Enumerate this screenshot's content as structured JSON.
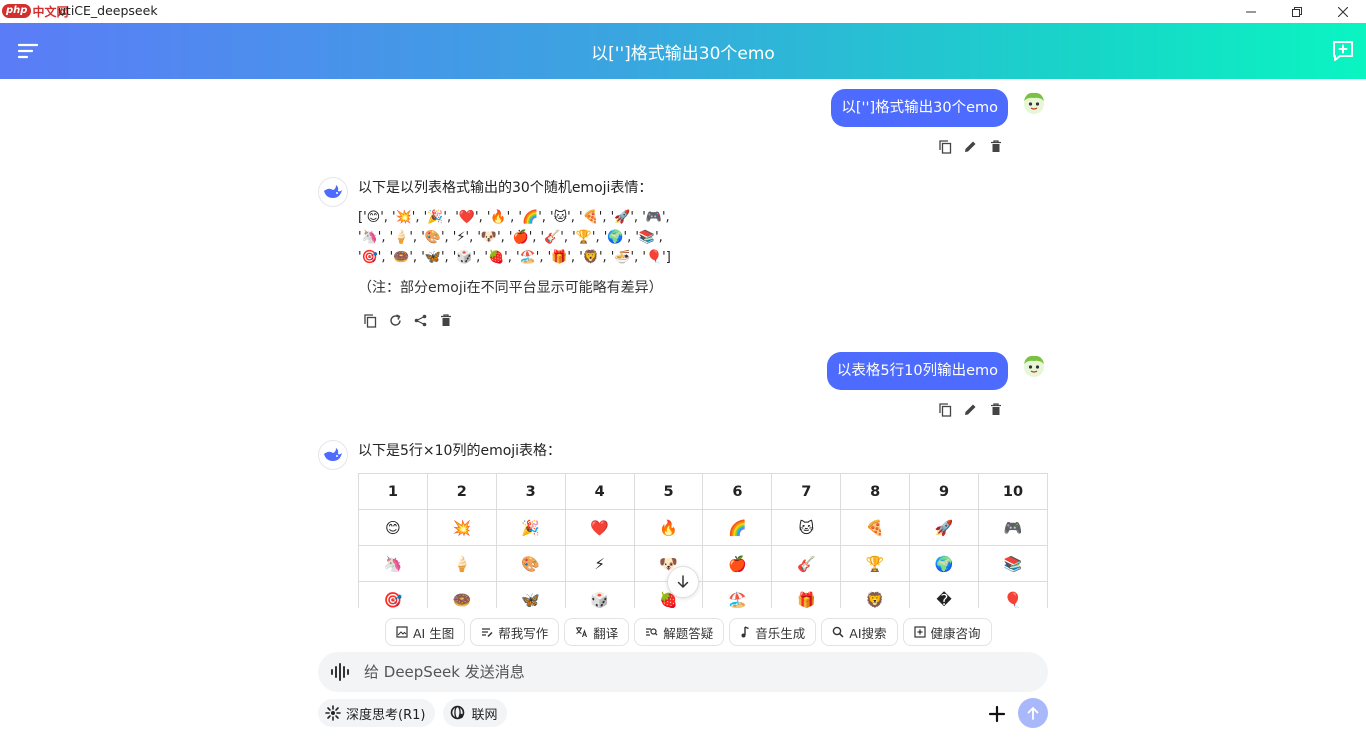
{
  "window": {
    "logo_php": "php",
    "logo_cn": "中文网",
    "title": "utiCE_deepseek"
  },
  "header": {
    "title": "以['']格式输出30个emo"
  },
  "messages": [
    {
      "role": "user",
      "text": "以['']格式输出30个emo"
    },
    {
      "role": "assistant",
      "intro": "以下是以列表格式输出的30个随机emoji表情：",
      "lines": [
        "['😊', '💥', '🎉', '❤️', '🔥', '🌈', '🐱', '🍕', '🚀', '🎮',",
        "'🦄', '🍦', '🎨', '⚡', '🐶', '🍎', '🎸', '🏆', '🌍', '📚',",
        "'🎯', '🍩', '🦋', '🎲', '🍓', '🏖️', '🎁', '🦁', '🍜', '🎈']"
      ],
      "note": "（注：部分emoji在不同平台显示可能略有差异）"
    },
    {
      "role": "user",
      "text": "以表格5行10列输出emo"
    },
    {
      "role": "assistant",
      "intro": "以下是5行×10列的emoji表格：",
      "table": {
        "headers": [
          "1",
          "2",
          "3",
          "4",
          "5",
          "6",
          "7",
          "8",
          "9",
          "10"
        ],
        "rows": [
          [
            "😊",
            "💥",
            "🎉",
            "❤️",
            "🔥",
            "🌈",
            "🐱",
            "🍕",
            "🚀",
            "🎮"
          ],
          [
            "🦄",
            "🍦",
            "🎨",
            "⚡",
            "🐶",
            "🍎",
            "🎸",
            "🏆",
            "🌍",
            "📚"
          ],
          [
            "🎯",
            "🍩",
            "🦋",
            "🎲",
            "🍓",
            "🏖️",
            "🎁",
            "🦁",
            "�",
            "🎈"
          ]
        ]
      }
    }
  ],
  "chips": [
    {
      "icon": "image-icon",
      "label": "AI 生图"
    },
    {
      "icon": "write-icon",
      "label": "帮我写作"
    },
    {
      "icon": "translate-icon",
      "label": "翻译"
    },
    {
      "icon": "solve-icon",
      "label": "解题答疑"
    },
    {
      "icon": "music-icon",
      "label": "音乐生成"
    },
    {
      "icon": "search-icon",
      "label": "AI搜索"
    },
    {
      "icon": "health-icon",
      "label": "健康咨询"
    }
  ],
  "input": {
    "placeholder": "给 DeepSeek 发送消息"
  },
  "toggles": {
    "deep_think": "深度思考(R1)",
    "web": "联网"
  },
  "colors": {
    "accent": "#4d6bfe",
    "send_disabled": "#a9b8fb"
  }
}
